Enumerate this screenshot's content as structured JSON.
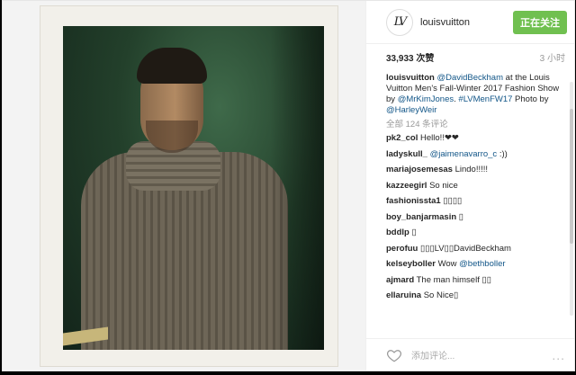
{
  "post": {
    "username": "louisvuitton",
    "avatar_text": "LV",
    "follow_label": "正在关注",
    "likes": "33,933 次赞",
    "time": "3 小时"
  },
  "caption": {
    "user": "louisvuitton",
    "text_1": " ",
    "mention_1": "@DavidBeckham",
    "text_2": " at the Louis Vuitton Men's Fall-Winter 2017 Fashion Show by ",
    "mention_2": "@MrKimJones",
    "text_3": ". ",
    "hashtag": "#LVMenFW17",
    "text_4": " Photo by ",
    "mention_3": "@HarleyWeir"
  },
  "all_comments": "全部 124 条评论",
  "comments": [
    {
      "user": "pk2_col",
      "text": "Hello!!❤❤",
      "mention": ""
    },
    {
      "user": "ladyskull_",
      "text": "",
      "mention": "@jaimenavarro_c",
      "after": " :))"
    },
    {
      "user": "mariajosemesas",
      "text": "Lindo!!!!!",
      "mention": ""
    },
    {
      "user": "kazzeegirl",
      "text": "So nice",
      "mention": ""
    },
    {
      "user": "fashionissta1",
      "text": "▯▯▯▯",
      "mention": ""
    },
    {
      "user": "boy_banjarmasin",
      "text": "▯",
      "mention": ""
    },
    {
      "user": "bddlp",
      "text": "▯",
      "mention": ""
    },
    {
      "user": "perofuu",
      "text": "▯▯▯LV▯▯DavidBeckham",
      "mention": ""
    },
    {
      "user": "kelseyboller",
      "text": "Wow ",
      "mention": "@bethboller"
    },
    {
      "user": "ajmard",
      "text": "The man himself ▯▯",
      "mention": ""
    },
    {
      "user": "ellaruina",
      "text": "So Nice▯",
      "mention": ""
    }
  ],
  "footer": {
    "add_comment_placeholder": "添加评论...",
    "more_label": "..."
  },
  "colors": {
    "follow": "#70c050",
    "mention": "#125688"
  }
}
